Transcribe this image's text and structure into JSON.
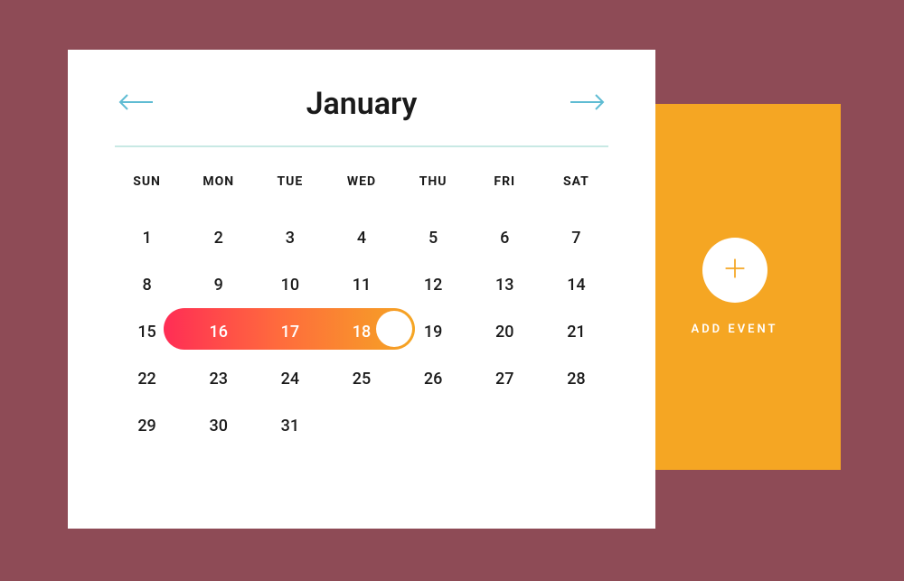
{
  "calendar": {
    "month_title": "January",
    "weekdays": [
      "SUN",
      "MON",
      "TUE",
      "WED",
      "THU",
      "FRI",
      "SAT"
    ],
    "days": [
      "1",
      "2",
      "3",
      "4",
      "5",
      "6",
      "7",
      "8",
      "9",
      "10",
      "11",
      "12",
      "13",
      "14",
      "15",
      "16",
      "17",
      "18",
      "19",
      "20",
      "21",
      "22",
      "23",
      "24",
      "25",
      "26",
      "27",
      "28",
      "29",
      "30",
      "31"
    ],
    "range_start_index": 15,
    "range_end_index": 18
  },
  "event_panel": {
    "add_label": "ADD EVENT"
  }
}
